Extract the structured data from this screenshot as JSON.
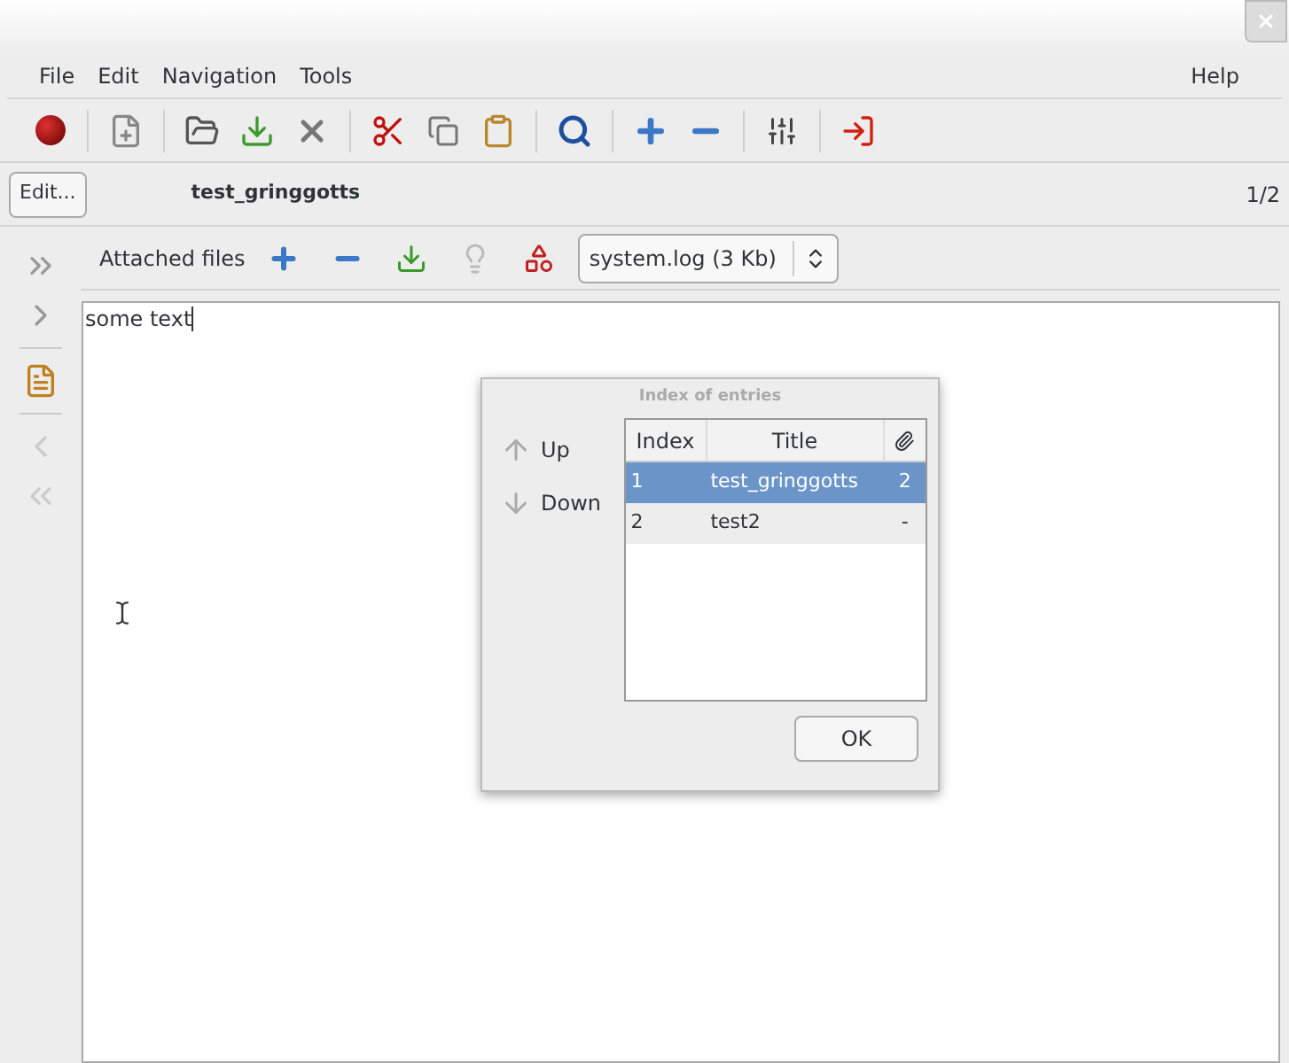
{
  "menu": {
    "left": [
      "File",
      "Edit",
      "Navigation",
      "Tools"
    ],
    "right": [
      "Help"
    ]
  },
  "entry_bar": {
    "edit_button": "Edit...",
    "title": "test_gringgotts",
    "counter": "1/2"
  },
  "attachments": {
    "label": "Attached files",
    "file_select": "system.log (3 Kb)"
  },
  "editor": {
    "text": "some text"
  },
  "dialog": {
    "title": "Index of entries",
    "move_buttons": [
      "Up",
      "Down"
    ],
    "table": {
      "columns": [
        "Index",
        "Title"
      ],
      "rows": [
        {
          "index": "1",
          "title": "test_gringgotts",
          "attachments": "2",
          "selected": true
        },
        {
          "index": "2",
          "title": "test2",
          "attachments": "-",
          "selected": false
        }
      ]
    },
    "ok_button": "OK"
  }
}
